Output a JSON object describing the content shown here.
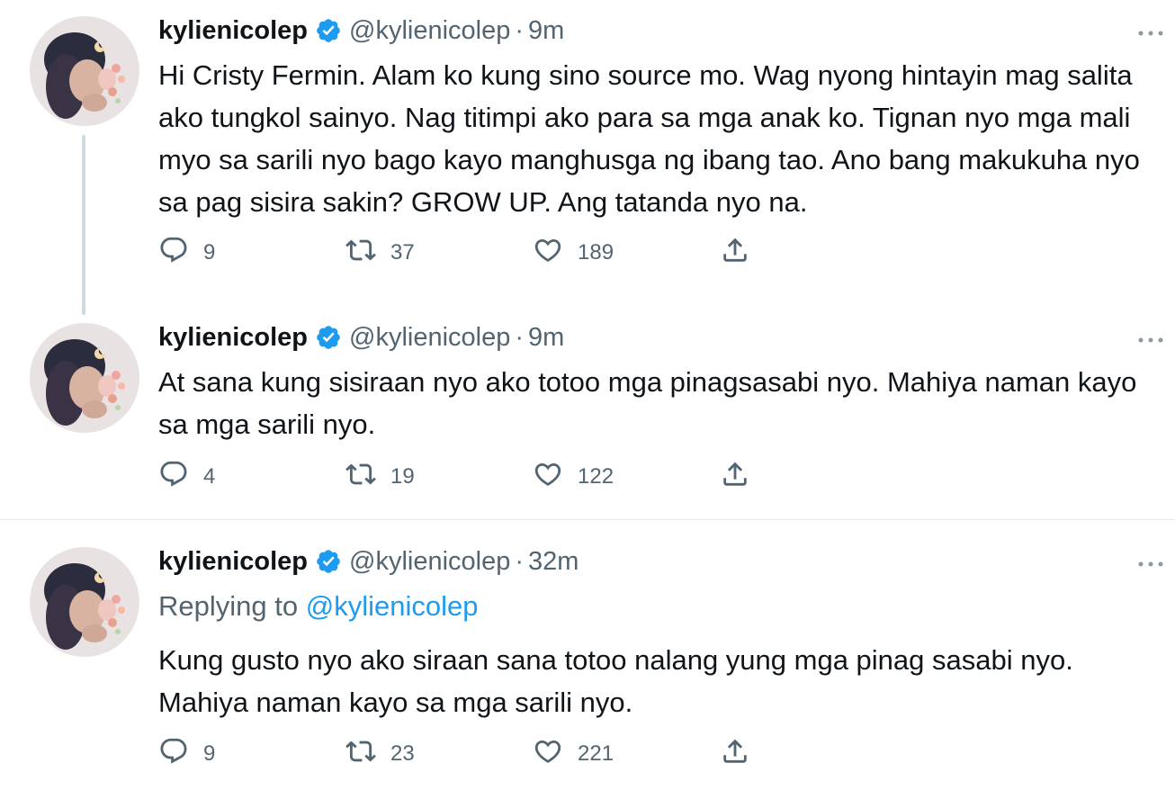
{
  "tweets": [
    {
      "name": "kylienicolep",
      "handle": "@kylienicolep",
      "separator": "·",
      "time": "9m",
      "text": "Hi Cristy Fermin. Alam ko kung sino source mo. Wag nyong hintayin mag salita ako tungkol sainyo. Nag titimpi ako para sa mga anak ko. Tignan nyo mga mali myo sa sarili nyo bago kayo manghusga ng ibang tao. Ano bang makukuha nyo sa pag sisira sakin? GROW UP. Ang tatanda nyo na.",
      "replies": "9",
      "retweets": "37",
      "likes": "189"
    },
    {
      "name": "kylienicolep",
      "handle": "@kylienicolep",
      "separator": "·",
      "time": "9m",
      "text": "At sana kung sisiraan nyo ako totoo mga pinagsasabi nyo. Mahiya naman kayo sa mga sarili nyo.",
      "replies": "4",
      "retweets": "19",
      "likes": "122"
    },
    {
      "name": "kylienicolep",
      "handle": "@kylienicolep",
      "separator": "·",
      "time": "32m",
      "replying_prefix": "Replying to",
      "replying_to": "@kylienicolep",
      "text": "Kung gusto nyo ako siraan sana totoo nalang yung mga pinag sasabi nyo. Mahiya naman kayo sa mga sarili nyo.",
      "replies": "9",
      "retweets": "23",
      "likes": "221"
    }
  ],
  "icons": {
    "verified": "verified-badge-icon",
    "more": "more-options-icon",
    "reply": "reply-icon",
    "retweet": "retweet-icon",
    "like": "heart-icon",
    "share": "share-icon"
  },
  "colors": {
    "text_primary": "#0f1419",
    "text_secondary": "#536471",
    "accent_blue": "#1d9bf0",
    "verified_blue": "#1d9bf0",
    "divider": "#e1e6ea",
    "thread_line": "#cfd9de"
  }
}
